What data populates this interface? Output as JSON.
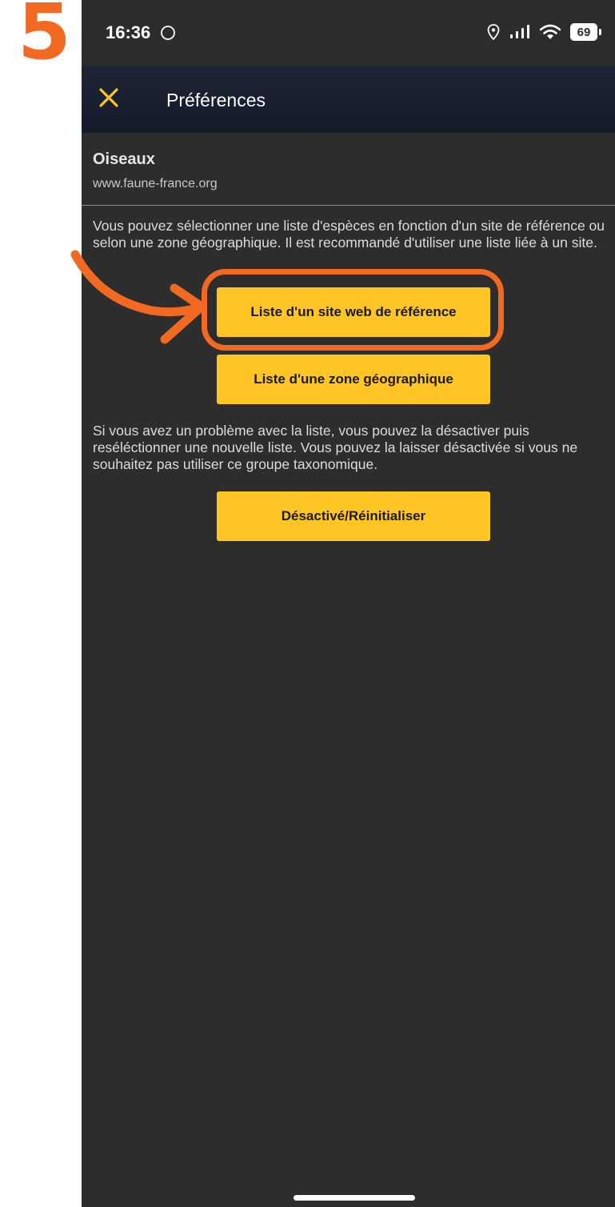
{
  "step_number": "5",
  "status_bar": {
    "time": "16:36",
    "battery_level": "69"
  },
  "app_bar": {
    "title": "Préférences",
    "close_icon": "close-icon",
    "accent_color": "#FFC524"
  },
  "group": {
    "name": "Oiseaux",
    "site": "www.faune-france.org"
  },
  "intro_text": "Vous pouvez sélectionner une liste d'espèces en fonction d'un site de référence ou selon une zone géographique. Il est recommandé d'utiliser une liste liée à un site.",
  "buttons": {
    "site_list": "Liste d'un site web de référence",
    "zone_list": "Liste d'une zone géographique",
    "reset": "Désactivé/Réinitialiser"
  },
  "reset_text": "Si vous avez un problème avec la liste, vous pouvez la désactiver puis reséléctionner une nouvelle liste. Vous pouvez la laisser désactivée si vous ne souhaitez pas utiliser ce groupe taxonomique.",
  "annotation": {
    "color": "#F26A21",
    "highlighted": "site_list"
  }
}
